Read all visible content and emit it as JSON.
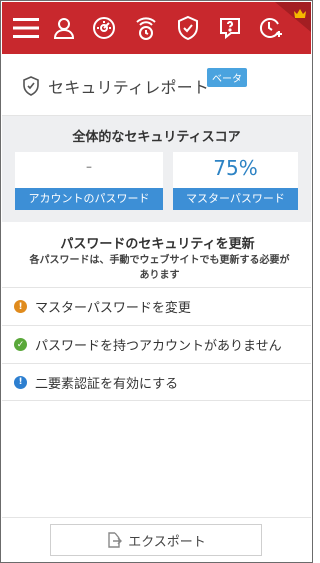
{
  "header": {
    "title": "セキュリティレポート",
    "beta_badge": "ベータ"
  },
  "topbar": {
    "icons": [
      "menu-icon",
      "user-icon",
      "dashboard-icon",
      "broadcast-icon",
      "shield-check-icon",
      "help-icon",
      "clock-add-icon",
      "crown-icon"
    ],
    "background": "#c8282d"
  },
  "score": {
    "heading": "全体的なセキュリティスコア",
    "account_value": "-",
    "account_label": "アカウントのパスワード",
    "master_value": "75%",
    "master_label": "マスターパスワード"
  },
  "update": {
    "title": "パスワードのセキュリティを更新",
    "subtitle": "各パスワードは、手動でウェブサイトでも更新する必要があります"
  },
  "items": [
    {
      "label": "マスターパスワードを変更",
      "status": "warning",
      "color": "#e08b1d",
      "symbol": "!"
    },
    {
      "label": "パスワードを持つアカウントがありません",
      "status": "ok",
      "color": "#5aa83a",
      "symbol": "✓"
    },
    {
      "label": "二要素認証を有効にする",
      "status": "info",
      "color": "#2d7fd0",
      "symbol": "!"
    }
  ],
  "footer": {
    "export_label": "エクスポート"
  },
  "colors": {
    "accent": "#3d8fd6",
    "brand_red": "#c8282d"
  }
}
